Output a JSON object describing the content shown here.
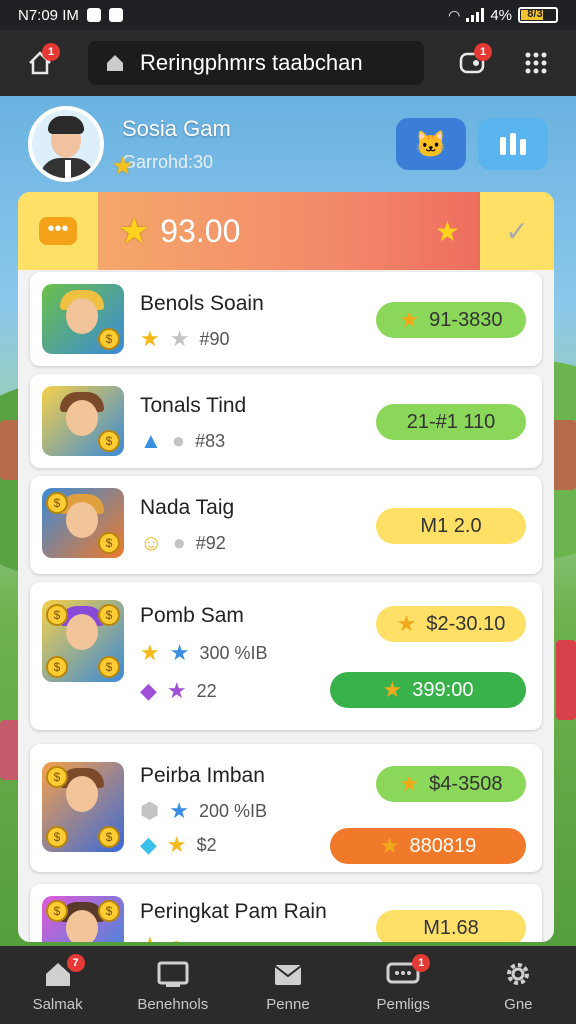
{
  "status_bar": {
    "time": "N7:09 IM",
    "battery": "8/31",
    "battery_pct": "4%"
  },
  "app_bar": {
    "home_badge": "1",
    "search_text": "Reringphmrs taabchan",
    "chat_badge": "1"
  },
  "profile": {
    "name": "Sosia Gam",
    "subtitle": "Garrohd:30"
  },
  "score": {
    "value": "93.00"
  },
  "cards": [
    {
      "title": "Benols Soain",
      "meta_value": "#90",
      "pill_label": "91-3830",
      "pill_color": "#8bd75a"
    },
    {
      "title": "Tonals Tind",
      "meta_value": "#83",
      "pill_label": "21-#1 110",
      "pill_color": "#8bd75a"
    },
    {
      "title": "Nada Taig",
      "meta_value": "#92",
      "pill_label": "M1 2.0",
      "pill_color": "#ffe066"
    },
    {
      "title": "Pomb Sam",
      "meta_value_1": "300 %IB",
      "meta_value_2": "22",
      "pill_label": "$2-30.10",
      "pill2_label": "399:00",
      "pill_color": "#ffe066"
    },
    {
      "title": "Peirba Imban",
      "meta_value_1": "200 %IB",
      "meta_value_2": "$2",
      "pill_label": "$4-3508",
      "pill2_label": "880819",
      "pill_color": "#8bd75a"
    },
    {
      "title": "Peringkat Pam Rain",
      "pill_label": "M1.68",
      "pill_color": "#ffe066"
    }
  ],
  "bottom_nav": [
    {
      "label": "Salmak",
      "icon": "home-icon",
      "badge": "7"
    },
    {
      "label": "Benehnols",
      "icon": "screen-icon"
    },
    {
      "label": "Penne",
      "icon": "mail-icon"
    },
    {
      "label": "Pemligs",
      "icon": "chat-icon",
      "badge": "1"
    },
    {
      "label": "Gne",
      "icon": "gear-icon"
    }
  ]
}
